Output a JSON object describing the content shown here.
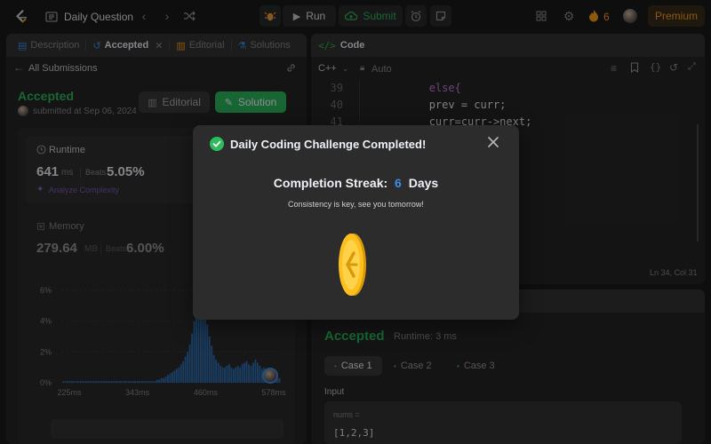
{
  "topbar": {
    "problem_list_label": "Daily Question",
    "run_label": "Run",
    "submit_label": "Submit",
    "streak_count": "6",
    "premium_label": "Premium"
  },
  "left_panel": {
    "tabs": [
      {
        "label": "Description"
      },
      {
        "label": "Accepted"
      },
      {
        "label": "Editorial"
      },
      {
        "label": "Solutions"
      }
    ],
    "back_label": "All Submissions",
    "status": "Accepted",
    "submitted_text": "submitted at Sep 06, 2024",
    "editorial_button": "Editorial",
    "solution_button": "Solution",
    "runtime": {
      "title": "Runtime",
      "value": "641",
      "unit": "ms",
      "beats_label": "Beats",
      "beats_value": "5.05%",
      "analyze_label": "Analyze Complexity"
    },
    "memory": {
      "title": "Memory",
      "value": "279.64",
      "unit": "MB",
      "beats_label": "Beats",
      "beats_value": "6.00%"
    }
  },
  "chart_data": {
    "type": "bar",
    "y_ticks": [
      "6%",
      "4%",
      "2%",
      "0%"
    ],
    "ylim": [
      0,
      6
    ],
    "x_ticks": [
      "225ms",
      "343ms",
      "460ms",
      "578ms"
    ],
    "bar_color": "#2f6fb4",
    "values": [
      0.1,
      0.1,
      0.1,
      0.1,
      0.1,
      0.1,
      0.1,
      0.1,
      0.1,
      0.1,
      0.1,
      0.1,
      0.1,
      0.1,
      0.1,
      0.1,
      0.1,
      0.1,
      0.1,
      0.1,
      0.1,
      0.1,
      0.1,
      0.1,
      0.1,
      0.1,
      0.1,
      0.1,
      0.1,
      0.1,
      0.1,
      0.1,
      0.1,
      0.1,
      0.1,
      0.1,
      0.1,
      0.1,
      0.1,
      0.1,
      0.1,
      0.1,
      0.1,
      0.2,
      0.2,
      0.3,
      0.3,
      0.4,
      0.5,
      0.6,
      0.7,
      0.8,
      0.9,
      1.0,
      1.2,
      1.4,
      1.7,
      2.0,
      2.5,
      3.2,
      4.0,
      4.8,
      5.4,
      5.6,
      5.2,
      4.5,
      3.8,
      3.0,
      2.4,
      1.8,
      1.5,
      1.3,
      1.1,
      1.0,
      1.0,
      1.1,
      1.2,
      1.0,
      0.9,
      1.0,
      1.1,
      1.0,
      1.2,
      1.3,
      1.4,
      1.2,
      1.1,
      1.3,
      1.5,
      1.3,
      1.1,
      0.9,
      1.0,
      0.7,
      0.6,
      0.5,
      0.4,
      0.4,
      0.3,
      0.3
    ]
  },
  "editor": {
    "tab_label": "Code",
    "language": "C++",
    "mode": "Auto",
    "lines": [
      {
        "num": "39",
        "code": "            else{"
      },
      {
        "num": "40",
        "code": "            prev = curr;"
      },
      {
        "num": "41",
        "code": "            curr=curr->next;"
      }
    ],
    "cursor_pos": "Ln 34, Col 31"
  },
  "results": {
    "status": "Accepted",
    "runtime_text": "Runtime: 3 ms",
    "cases": [
      "Case 1",
      "Case 2",
      "Case 3"
    ],
    "input_label": "Input",
    "var_name": "nums =",
    "var_value": "[1,2,3]"
  },
  "modal": {
    "title": "Daily Coding Challenge Completed!",
    "streak_label": "Completion Streak:",
    "streak_value": "6",
    "streak_unit": "Days",
    "message": "Consistency is key, see you tomorrow!"
  },
  "colors": {
    "accent_green": "#2cbb5d",
    "accent_blue": "#3f8ce8",
    "streak_orange": "#ffa116",
    "coin_gold": "#ffc01e"
  }
}
